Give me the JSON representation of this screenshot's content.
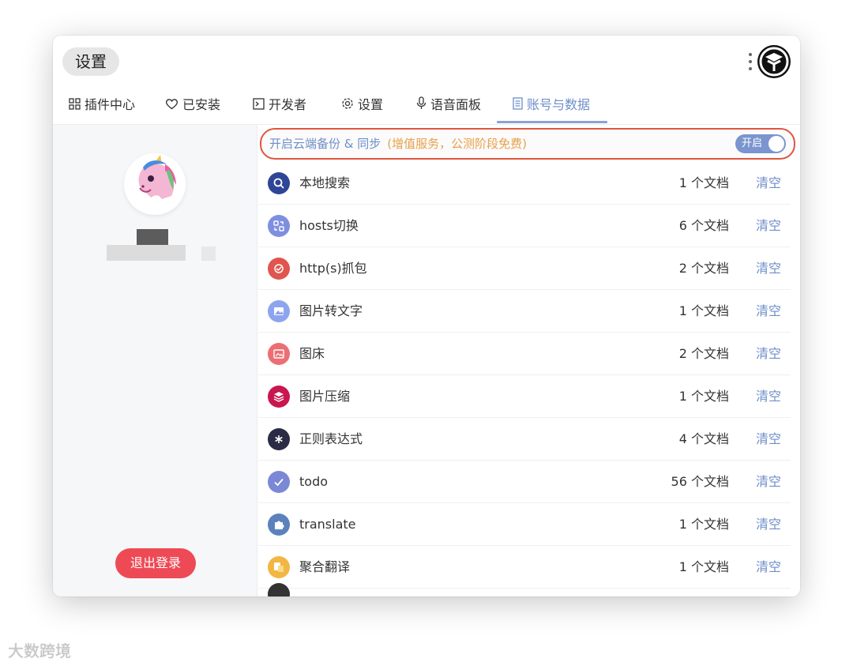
{
  "window": {
    "title": "设置"
  },
  "tabs": [
    {
      "label": "插件中心",
      "icon": "grid-icon"
    },
    {
      "label": "已安装",
      "icon": "heart-icon"
    },
    {
      "label": "开发者",
      "icon": "terminal-icon"
    },
    {
      "label": "设置",
      "icon": "gear-icon"
    },
    {
      "label": "语音面板",
      "icon": "microphone-icon"
    },
    {
      "label": "账号与数据",
      "icon": "document-icon",
      "active": true
    }
  ],
  "sidebar": {
    "logout_label": "退出登录"
  },
  "sync": {
    "label": "开启云端备份 & 同步",
    "note": "(增值服务，公测阶段免费)",
    "toggle_label": "开启",
    "enabled": true
  },
  "plugins": [
    {
      "name": "本地搜索",
      "count": "1 个文档",
      "action": "清空",
      "icon": "search-icon",
      "color": "#2f4597"
    },
    {
      "name": "hosts切换",
      "count": "6 个文档",
      "action": "清空",
      "icon": "swap-icon",
      "color": "#7f8fe0"
    },
    {
      "name": "http(s)抓包",
      "count": "2 个文档",
      "action": "清空",
      "icon": "capture-icon",
      "color": "#e0554f"
    },
    {
      "name": "图片转文字",
      "count": "1 个文档",
      "action": "清空",
      "icon": "image-icon",
      "color": "#8ea4ee"
    },
    {
      "name": "图床",
      "count": "2 个文档",
      "action": "清空",
      "icon": "picture-icon",
      "color": "#ec6f74"
    },
    {
      "name": "图片压缩",
      "count": "1 个文档",
      "action": "清空",
      "icon": "layers-icon",
      "color": "#c9164f"
    },
    {
      "name": "正则表达式",
      "count": "4 个文档",
      "action": "清空",
      "icon": "asterisk-icon",
      "color": "#2a2b45"
    },
    {
      "name": "todo",
      "count": "56 个文档",
      "action": "清空",
      "icon": "check-icon",
      "color": "#7b88d6"
    },
    {
      "name": "translate",
      "count": "1 个文档",
      "action": "清空",
      "icon": "puzzle-icon",
      "color": "#5b82bd"
    },
    {
      "name": "聚合翻译",
      "count": "1 个文档",
      "action": "清空",
      "icon": "translate-icon",
      "color": "#f2b643"
    }
  ],
  "watermark": "大数跨境"
}
